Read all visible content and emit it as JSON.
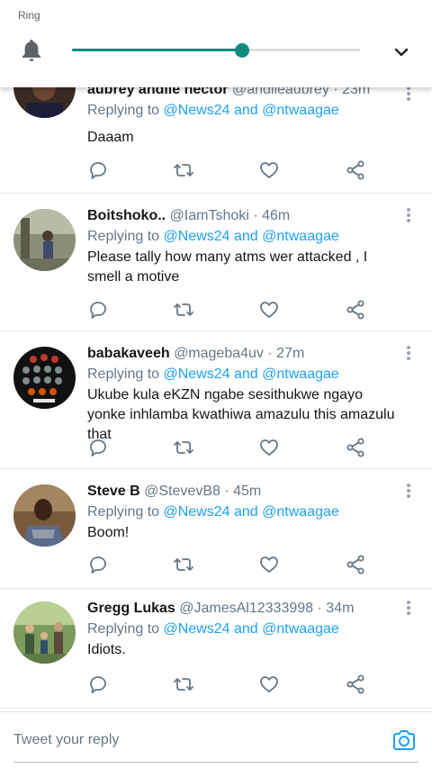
{
  "volume": {
    "label": "Ring",
    "level": 0.59,
    "accent": "#128a7e"
  },
  "tweets": [
    {
      "name": "aubrey andile nector",
      "handle": "@andileaubrey",
      "time": "23m",
      "reply_prefix": "Replying to",
      "mention1": "@News24",
      "reply_and": "and",
      "mention2": "@ntwaagae",
      "text": "Daaam"
    },
    {
      "name": "Boitshoko..",
      "handle": "@IamTshoki",
      "time": "46m",
      "reply_prefix": "Replying to",
      "mention1": "@News24",
      "reply_and": "and",
      "mention2": "@ntwaagae",
      "text": "Please tally how many atms wer attacked , I smell a motive"
    },
    {
      "name": "babakaveeh",
      "handle": "@mageba4uv",
      "time": "27m",
      "reply_prefix": "Replying to",
      "mention1": "@News24",
      "reply_and": "and",
      "mention2": "@ntwaagae",
      "text": "Ukube kula eKZN ngabe sesithukwe ngayo yonke inhlamba kwathiwa amazulu this amazulu that"
    },
    {
      "name": "Steve B",
      "handle": "@StevevB8",
      "time": "45m",
      "reply_prefix": "Replying to",
      "mention1": "@News24",
      "reply_and": "and",
      "mention2": "@ntwaagae",
      "text": "Boom!"
    },
    {
      "name": "Gregg Lukas",
      "handle": "@JamesAl12333998",
      "time": "34m",
      "reply_prefix": "Replying to",
      "mention1": "@News24",
      "reply_and": "and",
      "mention2": "@ntwaagae",
      "text": "Idiots."
    }
  ],
  "composer": {
    "placeholder": "Tweet your reply"
  },
  "colors": {
    "link": "#1da1f2",
    "secondary_text": "#657786",
    "icon": "#657786"
  }
}
